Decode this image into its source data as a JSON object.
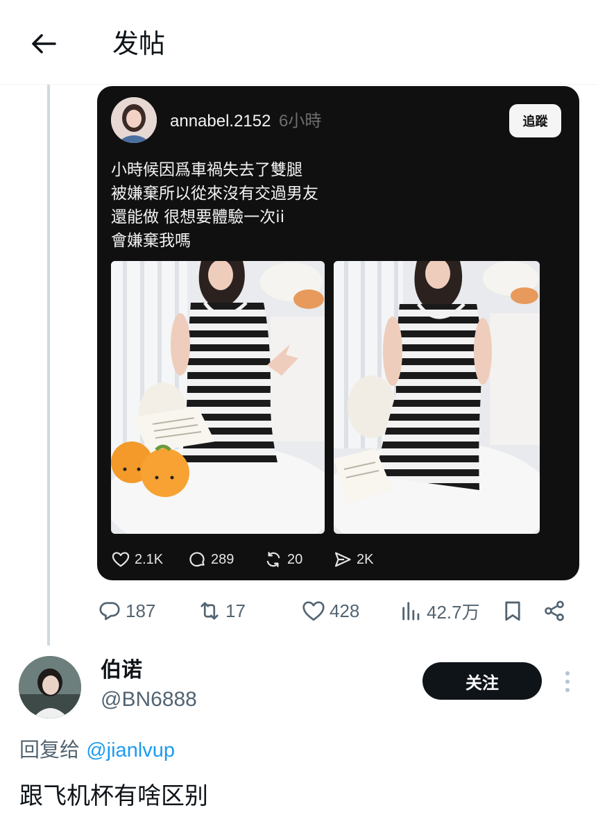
{
  "header": {
    "title": "发帖"
  },
  "embedded_post": {
    "username": "annabel.2152",
    "time": "6小時",
    "follow_label": "追蹤",
    "text_lines": [
      "小時候因爲車禍失去了雙腿",
      "被嫌棄所以從來沒有交過男友",
      "還能做 很想要體驗一次ii",
      "會嫌棄我嗎"
    ],
    "actions": {
      "likes": "2.1K",
      "comments": "289",
      "reposts": "20",
      "shares": "2K"
    }
  },
  "tweet_actions": {
    "replies": "187",
    "retweets": "17",
    "likes": "428",
    "views": "42.7万"
  },
  "reply": {
    "display_name": "伯诺",
    "handle": "@BN6888",
    "follow_label": "关注",
    "reply_to_prefix": "回复给",
    "reply_to_handle": "@jianlvup",
    "text": "跟飞机杯有啥区别"
  },
  "colors": {
    "accent": "#1d9bf0",
    "text": "#0f1419",
    "muted": "#536471",
    "card_bg": "#101010"
  }
}
